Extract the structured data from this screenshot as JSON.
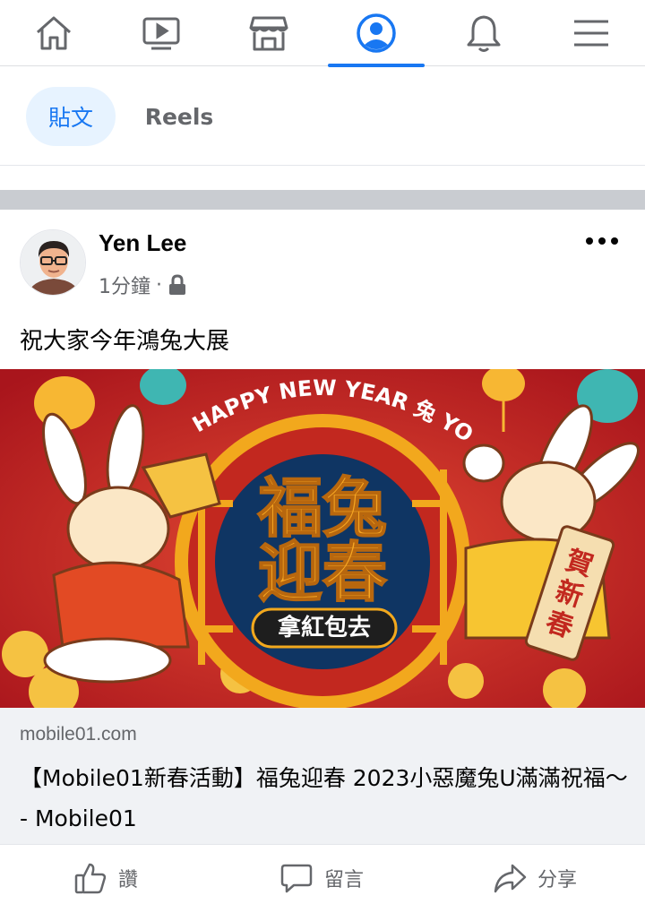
{
  "nav": {
    "items": [
      {
        "icon": "home-icon"
      },
      {
        "icon": "video-icon"
      },
      {
        "icon": "marketplace-icon"
      },
      {
        "icon": "profile-icon",
        "active": true
      },
      {
        "icon": "bell-icon"
      },
      {
        "icon": "menu-icon"
      }
    ],
    "accent": "#1877f2"
  },
  "filters": {
    "posts_label": "貼文",
    "reels_label": "Reels"
  },
  "post": {
    "author": "Yen Lee",
    "time": "1分鐘",
    "separator": "·",
    "privacy_icon": "lock-icon",
    "text": "祝大家今年鴻兔大展",
    "banner": {
      "arc_text": "HAPPY NEW YEAR 兔 YOU",
      "title_line1": "福兔",
      "title_line2": "迎春",
      "pill_text": "拿紅包去",
      "scroll_text": "賀新春"
    },
    "link": {
      "domain": "mobile01.com",
      "title": "【Mobile01新春活動】福兔迎春 2023小惡魔兔U滿滿祝福～ - Mobile01"
    },
    "actions": {
      "like": "讚",
      "comment": "留言",
      "share": "分享"
    }
  }
}
